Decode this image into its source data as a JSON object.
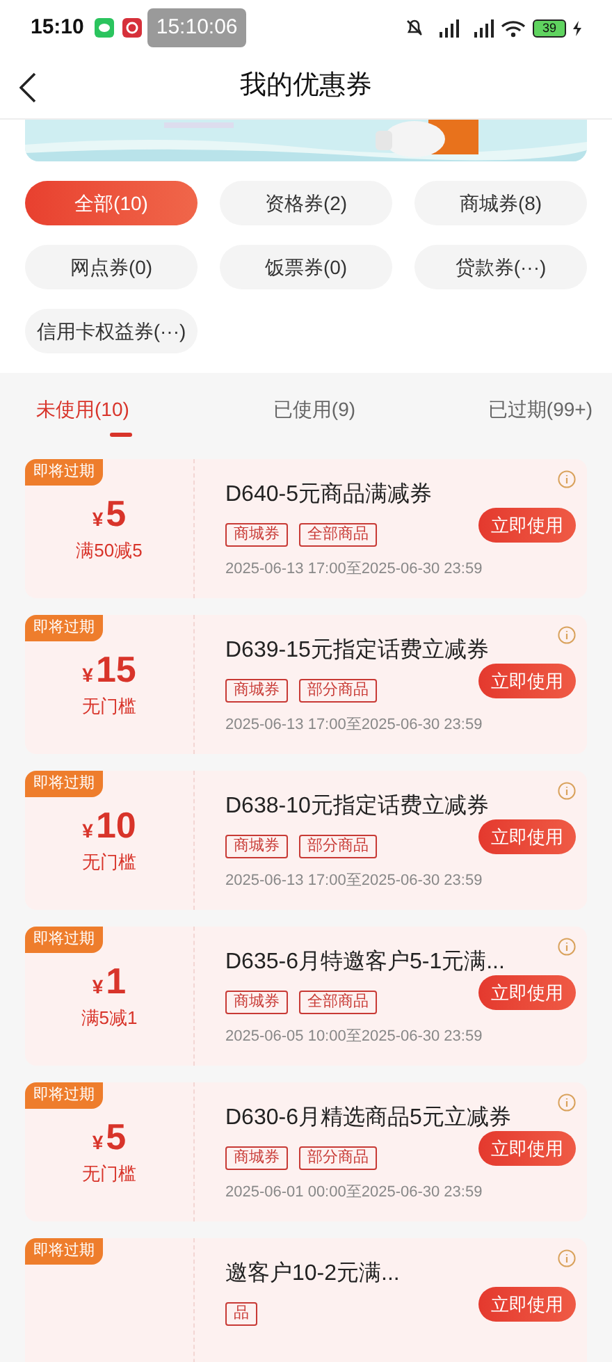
{
  "status_bar": {
    "time": "15:10",
    "timer": "15:10:06",
    "battery": "39"
  },
  "header": {
    "title": "我的优惠券"
  },
  "filters": [
    {
      "label": "全部(10)",
      "selected": true
    },
    {
      "label": "资格券(2)",
      "selected": false
    },
    {
      "label": "商城券(8)",
      "selected": false
    },
    {
      "label": "网点券(0)",
      "selected": false
    },
    {
      "label": "饭票券(0)",
      "selected": false
    },
    {
      "label": "贷款券(···)",
      "selected": false
    },
    {
      "label": "信用卡权益券(···)",
      "selected": false
    }
  ],
  "tabs": [
    {
      "label": "未使用(10)",
      "selected": true
    },
    {
      "label": "已使用(9)",
      "selected": false
    },
    {
      "label": "已过期(99+)",
      "selected": false
    }
  ],
  "coupons": [
    {
      "badge": "即将过期",
      "amount": "5",
      "currency": "¥",
      "condition": "满50减5",
      "title": "D640-5元商品满减券",
      "tags": [
        "商城券",
        "全部商品"
      ],
      "validity": "2025-06-13 17:00至2025-06-30 23:59",
      "button": "立即使用"
    },
    {
      "badge": "即将过期",
      "amount": "15",
      "currency": "¥",
      "condition": "无门槛",
      "title": "D639-15元指定话费立减券",
      "tags": [
        "商城券",
        "部分商品"
      ],
      "validity": "2025-06-13 17:00至2025-06-30 23:59",
      "button": "立即使用"
    },
    {
      "badge": "即将过期",
      "amount": "10",
      "currency": "¥",
      "condition": "无门槛",
      "title": "D638-10元指定话费立减券",
      "tags": [
        "商城券",
        "部分商品"
      ],
      "validity": "2025-06-13 17:00至2025-06-30 23:59",
      "button": "立即使用"
    },
    {
      "badge": "即将过期",
      "amount": "1",
      "currency": "¥",
      "condition": "满5减1",
      "title": "D635-6月特邀客户5-1元满...",
      "tags": [
        "商城券",
        "全部商品"
      ],
      "validity": "2025-06-05 10:00至2025-06-30 23:59",
      "button": "立即使用"
    },
    {
      "badge": "即将过期",
      "amount": "5",
      "currency": "¥",
      "condition": "无门槛",
      "title": "D630-6月精选商品5元立减券",
      "tags": [
        "商城券",
        "部分商品"
      ],
      "validity": "2025-06-01 00:00至2025-06-30 23:59",
      "button": "立即使用"
    },
    {
      "badge": "即将过期",
      "title": "邀客户10-2元满...",
      "tags": [
        "品"
      ],
      "button": "立即使用"
    }
  ]
}
